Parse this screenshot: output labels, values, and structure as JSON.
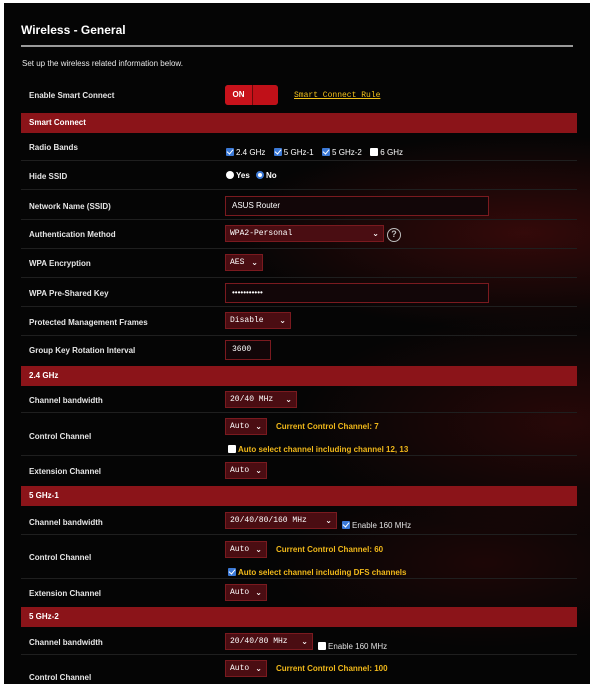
{
  "page": {
    "title": "Wireless - General",
    "description": "Set up the wireless related information below."
  },
  "smart_connect": {
    "label": "Enable Smart Connect",
    "toggle_state": "ON",
    "rule_link": "Smart Connect Rule"
  },
  "sections": {
    "smart_connect": "Smart Connect",
    "band_24": "2.4 GHz",
    "band_5_1": "5 GHz-1",
    "band_5_2": "5 GHz-2"
  },
  "general": {
    "radio_bands_label": "Radio Bands",
    "radio_bands": [
      {
        "label": "2.4 GHz",
        "checked": true
      },
      {
        "label": "5 GHz-1",
        "checked": true
      },
      {
        "label": "5 GHz-2",
        "checked": true
      },
      {
        "label": "6 GHz",
        "checked": false
      }
    ],
    "hide_ssid_label": "Hide SSID",
    "hide_ssid_yes": "Yes",
    "hide_ssid_no": "No",
    "hide_ssid_selected": "No",
    "ssid_label": "Network Name (SSID)",
    "ssid_value": "ASUS Router",
    "auth_label": "Authentication Method",
    "auth_value": "WPA2-Personal",
    "wpa_enc_label": "WPA Encryption",
    "wpa_enc_value": "AES",
    "psk_label": "WPA Pre-Shared Key",
    "psk_value": "•••••••••••",
    "pmf_label": "Protected Management Frames",
    "pmf_value": "Disable",
    "gkri_label": "Group Key Rotation Interval",
    "gkri_value": "3600"
  },
  "band_24": {
    "bw_label": "Channel bandwidth",
    "bw_value": "20/40 MHz",
    "ctrl_label": "Control Channel",
    "ctrl_value": "Auto",
    "current_channel": "Current Control Channel: 7",
    "auto_select_label": "Auto select channel including channel 12, 13",
    "auto_select_checked": false,
    "ext_label": "Extension Channel",
    "ext_value": "Auto"
  },
  "band_5_1": {
    "bw_label": "Channel bandwidth",
    "bw_value": "20/40/80/160 MHz",
    "enable160_label": "Enable 160 MHz",
    "enable160_checked": true,
    "ctrl_label": "Control Channel",
    "ctrl_value": "Auto",
    "current_channel": "Current Control Channel: 60",
    "auto_select_label": "Auto select channel including DFS channels",
    "auto_select_checked": true,
    "ext_label": "Extension Channel",
    "ext_value": "Auto"
  },
  "band_5_2": {
    "bw_label": "Channel bandwidth",
    "bw_value": "20/40/80 MHz",
    "enable160_label": "Enable 160 MHz",
    "enable160_checked": false,
    "ctrl_label": "Control Channel",
    "ctrl_value": "Auto",
    "current_channel": "Current Control Channel: 100"
  },
  "colors": {
    "section_bar": "#8b1419",
    "accent_red": "#c8121b",
    "link_yellow": "#f3c21a",
    "checkbox_blue": "#3b79d6"
  }
}
